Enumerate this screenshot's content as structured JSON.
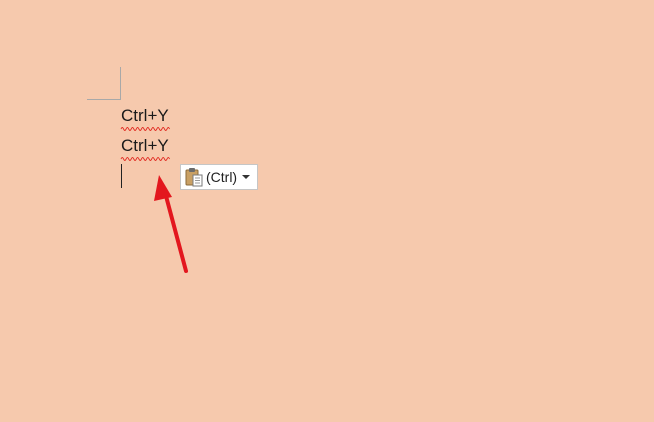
{
  "colors": {
    "page_background": "#f6c9ad",
    "margin_guide": "#a8a8a8",
    "spellcheck_underline": "#e0261d",
    "caret": "#222222",
    "annotation_arrow": "#e3171e"
  },
  "document": {
    "lines": [
      "Ctrl+Y",
      "Ctrl+Y"
    ]
  },
  "paste_options": {
    "icon": "clipboard-paste-icon",
    "label": "(Ctrl)",
    "dropdown_icon": "chevron-down-icon"
  },
  "annotation": {
    "icon": "red-arrow-icon"
  }
}
